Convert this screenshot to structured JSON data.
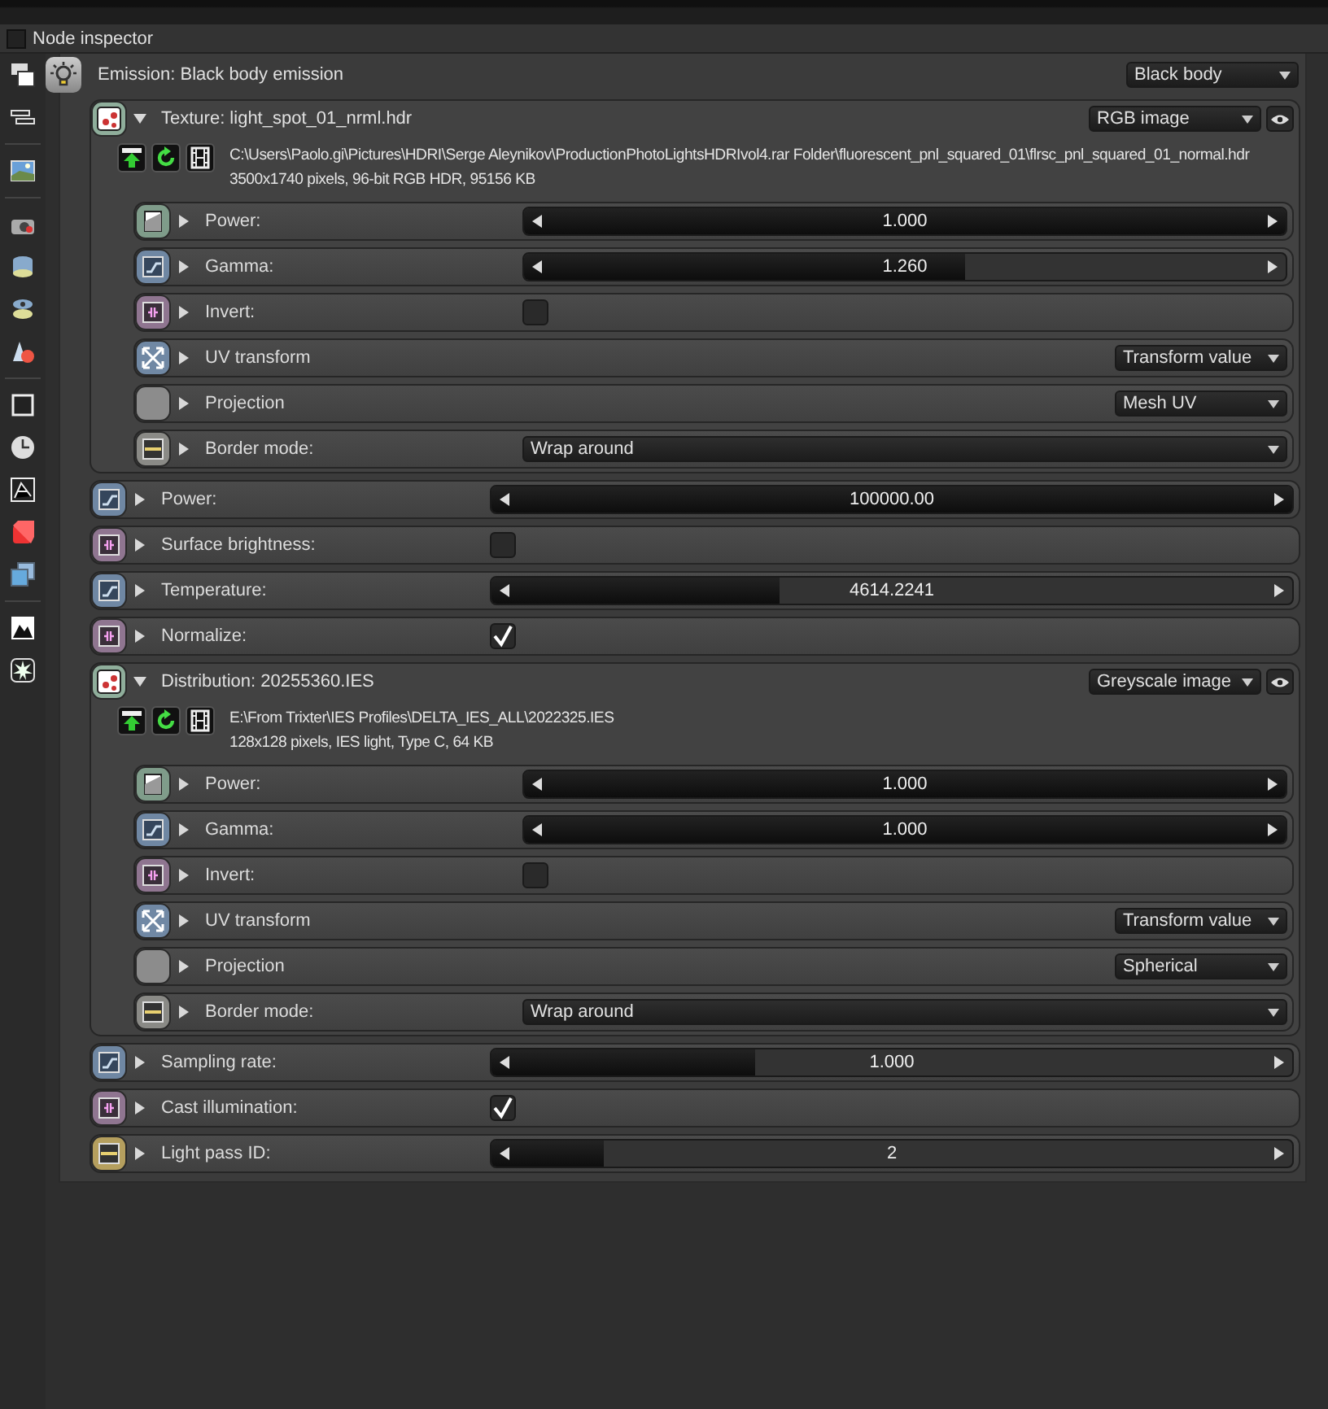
{
  "window": {
    "title": "Node inspector",
    "checked": false
  },
  "emission": {
    "label": "Emission: Black body emission",
    "dropdown": "Black body"
  },
  "sections": [
    {
      "kind": "group",
      "title": "Texture: light_spot_01_nrml.hdr",
      "expanded": true,
      "color": "#8fae9b",
      "mode": "RGB image",
      "path": "C:\\Users\\Paolo.gi\\Pictures\\HDRI\\Serge Aleynikov\\ProductionPhotoLightsHDRIvol4.rar Folder\\fluorescent_pnl_squared_01\\flrsc_pnl_squared_01_normal.hdr",
      "info": "3500x1740 pixels, 96-bit RGB HDR, 95156 KB",
      "params": [
        {
          "kind": "tex_slider",
          "label": "Power:",
          "expanded": false,
          "color": "#7f9c8a",
          "value": "1.000",
          "level": 1
        },
        {
          "kind": "slider",
          "label": "Gamma:",
          "expanded": false,
          "color": "#6f87a3",
          "value": "1.260",
          "level": 0.58
        },
        {
          "kind": "checkbox",
          "label": "Invert:",
          "expanded": false,
          "color": "#8f7590",
          "checked": false
        },
        {
          "kind": "transform",
          "label": "UV transform",
          "expanded": false,
          "color": "#7088a4",
          "value": "Transform value"
        },
        {
          "kind": "projection",
          "label": "Projection",
          "expanded": false,
          "color": "#8c8c8c",
          "value": "Mesh UV"
        },
        {
          "kind": "combo",
          "label": "Border mode:",
          "expanded": false,
          "color": "#8a8a86",
          "value": "Wrap around"
        }
      ]
    },
    {
      "kind": "slider",
      "label": "Power:",
      "expanded": false,
      "color": "#6f87a3",
      "value": "100000.00",
      "level": 1
    },
    {
      "kind": "checkbox",
      "label": "Surface brightness:",
      "expanded": false,
      "color": "#8f7590",
      "checked": false
    },
    {
      "kind": "slider",
      "label": "Temperature:",
      "expanded": false,
      "color": "#6f87a3",
      "value": "4614.2241",
      "level": 0.36
    },
    {
      "kind": "checkbox",
      "label": "Normalize:",
      "expanded": false,
      "color": "#8f7590",
      "checked": true
    },
    {
      "kind": "group",
      "title": "Distribution: 20255360.IES",
      "expanded": true,
      "color": "#8fae9b",
      "mode": "Greyscale image",
      "path": "E:\\From Trixter\\IES Profiles\\DELTA_IES_ALL\\2022325.IES",
      "info": "128x128 pixels, IES light, Type C, 64 KB",
      "params": [
        {
          "kind": "tex_slider",
          "label": "Power:",
          "expanded": false,
          "color": "#7f9c8a",
          "value": "1.000",
          "level": 1
        },
        {
          "kind": "slider",
          "label": "Gamma:",
          "expanded": false,
          "color": "#6f87a3",
          "value": "1.000",
          "level": 1
        },
        {
          "kind": "checkbox",
          "label": "Invert:",
          "expanded": false,
          "color": "#8f7590",
          "checked": false
        },
        {
          "kind": "transform",
          "label": "UV transform",
          "expanded": false,
          "color": "#7088a4",
          "value": "Transform value"
        },
        {
          "kind": "projection",
          "label": "Projection",
          "expanded": false,
          "color": "#8c8c8c",
          "value": "Spherical"
        },
        {
          "kind": "combo",
          "label": "Border mode:",
          "expanded": false,
          "color": "#8a8a86",
          "value": "Wrap around"
        }
      ]
    },
    {
      "kind": "slider",
      "label": "Sampling rate:",
      "expanded": false,
      "color": "#6f87a3",
      "value": "1.000",
      "level": 0.33
    },
    {
      "kind": "checkbox",
      "label": "Cast illumination:",
      "expanded": false,
      "color": "#8f7590",
      "checked": true
    },
    {
      "kind": "int_slider",
      "label": "Light pass ID:",
      "expanded": false,
      "color": "#b59f5e",
      "value": "2",
      "level": 0.14
    }
  ]
}
